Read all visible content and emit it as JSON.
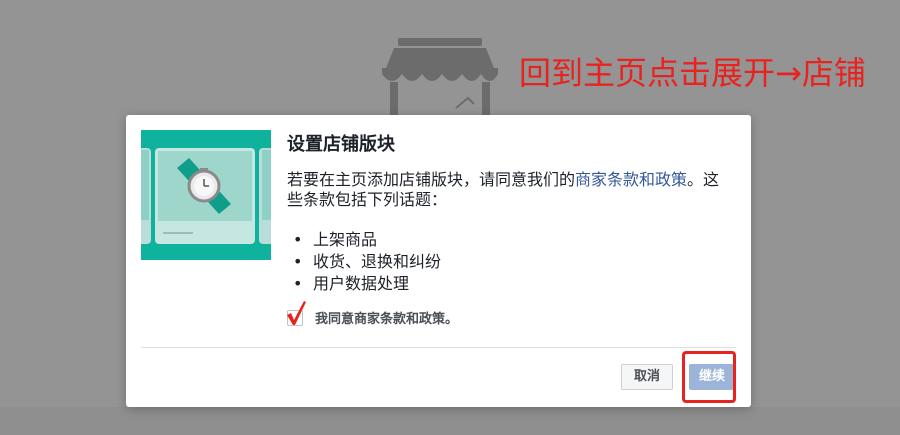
{
  "annotation": {
    "text": "回到主页点击展开→店铺",
    "color": "#e8231f"
  },
  "dialog": {
    "title": "设置店铺版块",
    "intro_before_link": "若要在主页添加店铺版块，请同意我们的",
    "terms_link": "商家条款和政策",
    "intro_after_link": "。这些条款包括下列话题：",
    "topics": [
      "上架商品",
      "收货、退换和纠纷",
      "用户数据处理"
    ],
    "agree_label": "我同意商家条款和政策。",
    "cancel_label": "取消",
    "continue_label": "继续"
  },
  "colors": {
    "overlay": "#949494",
    "illustration_bg": "#0fb39d",
    "link": "#365899",
    "continue_button": "#9cb4d8",
    "highlight": "#e8231f"
  }
}
